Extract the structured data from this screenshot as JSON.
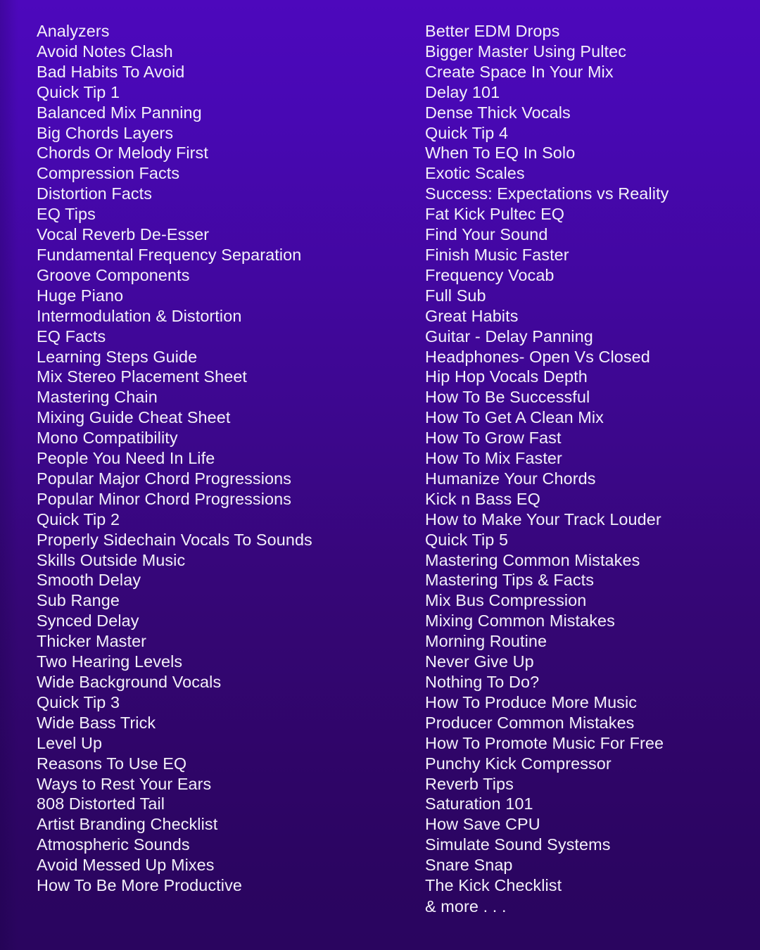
{
  "theme": {
    "background_top": "#4D08BC",
    "background_bottom": "#2A055F",
    "text_color": "#F4F1FA"
  },
  "columns": {
    "left": {
      "items": [
        "Analyzers",
        "Avoid Notes Clash",
        "Bad Habits To Avoid",
        "Quick Tip 1",
        "Balanced Mix Panning",
        "Big Chords Layers",
        "Chords Or Melody First",
        "Compression Facts",
        "Distortion Facts",
        "EQ Tips",
        "Vocal Reverb De-Esser",
        "Fundamental Frequency Separation",
        "Groove Components",
        "Huge Piano",
        "Intermodulation & Distortion",
        "EQ Facts",
        "Learning Steps Guide",
        "Mix Stereo Placement Sheet",
        "Mastering Chain",
        "Mixing Guide Cheat Sheet",
        "Mono Compatibility",
        "People You Need In Life",
        "Popular Major Chord Progressions",
        "Popular Minor Chord Progressions",
        "Quick Tip 2",
        "Properly Sidechain Vocals To Sounds",
        "Skills Outside Music",
        "Smooth Delay",
        "Sub Range",
        "Synced Delay",
        "Thicker Master",
        "Two Hearing Levels",
        "Wide Background Vocals",
        "Quick Tip 3",
        "Wide Bass Trick",
        "Level Up",
        "Reasons To Use EQ",
        "Ways to Rest Your Ears",
        "808 Distorted Tail",
        "Artist Branding Checklist",
        "Atmospheric Sounds",
        "Avoid Messed Up Mixes",
        "How To Be More Productive"
      ]
    },
    "right": {
      "items": [
        "Better EDM Drops",
        "Bigger Master Using Pultec",
        "Create Space In Your Mix",
        "Delay 101",
        "Dense Thick Vocals",
        "Quick Tip 4",
        "When To EQ In Solo",
        "Exotic Scales",
        "Success: Expectations vs Reality",
        "Fat Kick Pultec EQ",
        "Find Your Sound",
        "Finish Music Faster",
        "Frequency Vocab",
        "Full Sub",
        "Great Habits",
        "Guitar - Delay Panning",
        "Headphones- Open Vs Closed",
        "Hip Hop Vocals Depth",
        "How To Be Successful",
        "How To Get A Clean Mix",
        "How To Grow Fast",
        "How To Mix Faster",
        "Humanize Your Chords",
        "Kick n Bass EQ",
        "How to Make Your Track Louder",
        "Quick Tip 5",
        "Mastering Common Mistakes",
        "Mastering Tips & Facts",
        "Mix Bus Compression",
        "Mixing Common Mistakes",
        "Morning Routine",
        "Never Give Up",
        "Nothing To Do?",
        "How To Produce More Music",
        "Producer Common Mistakes",
        "How To Promote Music For Free",
        "Punchy Kick Compressor",
        "Reverb Tips",
        "Saturation 101",
        "How Save CPU",
        "Simulate Sound Systems",
        "Snare Snap",
        "The Kick Checklist"
      ],
      "more_label": "& more . . ."
    }
  }
}
